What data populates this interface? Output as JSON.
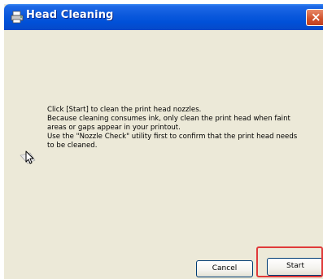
{
  "window": {
    "title": "Head Cleaning",
    "close_glyph": "×"
  },
  "message": {
    "lines": [
      "Click [Start] to clean the print head nozzles.",
      "Because cleaning consumes ink, only clean the print head when faint",
      "areas or gaps appear in your printout.",
      "Use the \"Nozzle Check\" utility first to confirm that the print head needs",
      "to be cleaned."
    ]
  },
  "buttons": {
    "cancel_label": "Cancel",
    "start_label": "Start"
  },
  "icons": {
    "title": "printer-icon",
    "message": "pointer-cursor-icon"
  },
  "colors": {
    "titlebar": "#0a58dc",
    "dialog_bg": "#ece9d8",
    "highlight": "#e03a3a"
  }
}
